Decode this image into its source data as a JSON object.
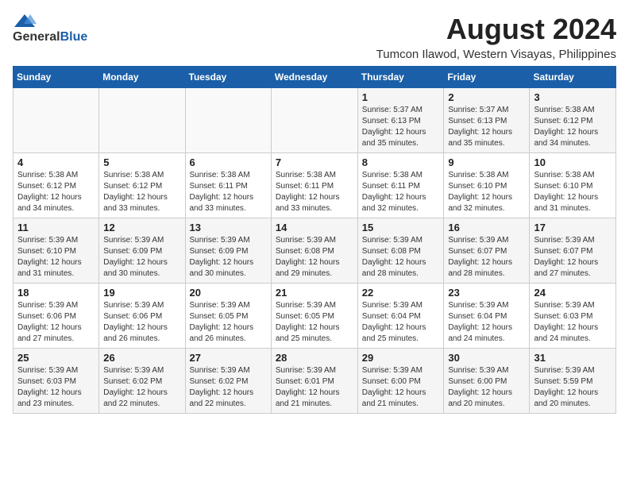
{
  "logo": {
    "general": "General",
    "blue": "Blue"
  },
  "title": {
    "month_year": "August 2024",
    "location": "Tumcon Ilawod, Western Visayas, Philippines"
  },
  "weekdays": [
    "Sunday",
    "Monday",
    "Tuesday",
    "Wednesday",
    "Thursday",
    "Friday",
    "Saturday"
  ],
  "weeks": [
    [
      {
        "day": "",
        "info": ""
      },
      {
        "day": "",
        "info": ""
      },
      {
        "day": "",
        "info": ""
      },
      {
        "day": "",
        "info": ""
      },
      {
        "day": "1",
        "info": "Sunrise: 5:37 AM\nSunset: 6:13 PM\nDaylight: 12 hours\nand 35 minutes."
      },
      {
        "day": "2",
        "info": "Sunrise: 5:37 AM\nSunset: 6:13 PM\nDaylight: 12 hours\nand 35 minutes."
      },
      {
        "day": "3",
        "info": "Sunrise: 5:38 AM\nSunset: 6:12 PM\nDaylight: 12 hours\nand 34 minutes."
      }
    ],
    [
      {
        "day": "4",
        "info": "Sunrise: 5:38 AM\nSunset: 6:12 PM\nDaylight: 12 hours\nand 34 minutes."
      },
      {
        "day": "5",
        "info": "Sunrise: 5:38 AM\nSunset: 6:12 PM\nDaylight: 12 hours\nand 33 minutes."
      },
      {
        "day": "6",
        "info": "Sunrise: 5:38 AM\nSunset: 6:11 PM\nDaylight: 12 hours\nand 33 minutes."
      },
      {
        "day": "7",
        "info": "Sunrise: 5:38 AM\nSunset: 6:11 PM\nDaylight: 12 hours\nand 33 minutes."
      },
      {
        "day": "8",
        "info": "Sunrise: 5:38 AM\nSunset: 6:11 PM\nDaylight: 12 hours\nand 32 minutes."
      },
      {
        "day": "9",
        "info": "Sunrise: 5:38 AM\nSunset: 6:10 PM\nDaylight: 12 hours\nand 32 minutes."
      },
      {
        "day": "10",
        "info": "Sunrise: 5:38 AM\nSunset: 6:10 PM\nDaylight: 12 hours\nand 31 minutes."
      }
    ],
    [
      {
        "day": "11",
        "info": "Sunrise: 5:39 AM\nSunset: 6:10 PM\nDaylight: 12 hours\nand 31 minutes."
      },
      {
        "day": "12",
        "info": "Sunrise: 5:39 AM\nSunset: 6:09 PM\nDaylight: 12 hours\nand 30 minutes."
      },
      {
        "day": "13",
        "info": "Sunrise: 5:39 AM\nSunset: 6:09 PM\nDaylight: 12 hours\nand 30 minutes."
      },
      {
        "day": "14",
        "info": "Sunrise: 5:39 AM\nSunset: 6:08 PM\nDaylight: 12 hours\nand 29 minutes."
      },
      {
        "day": "15",
        "info": "Sunrise: 5:39 AM\nSunset: 6:08 PM\nDaylight: 12 hours\nand 28 minutes."
      },
      {
        "day": "16",
        "info": "Sunrise: 5:39 AM\nSunset: 6:07 PM\nDaylight: 12 hours\nand 28 minutes."
      },
      {
        "day": "17",
        "info": "Sunrise: 5:39 AM\nSunset: 6:07 PM\nDaylight: 12 hours\nand 27 minutes."
      }
    ],
    [
      {
        "day": "18",
        "info": "Sunrise: 5:39 AM\nSunset: 6:06 PM\nDaylight: 12 hours\nand 27 minutes."
      },
      {
        "day": "19",
        "info": "Sunrise: 5:39 AM\nSunset: 6:06 PM\nDaylight: 12 hours\nand 26 minutes."
      },
      {
        "day": "20",
        "info": "Sunrise: 5:39 AM\nSunset: 6:05 PM\nDaylight: 12 hours\nand 26 minutes."
      },
      {
        "day": "21",
        "info": "Sunrise: 5:39 AM\nSunset: 6:05 PM\nDaylight: 12 hours\nand 25 minutes."
      },
      {
        "day": "22",
        "info": "Sunrise: 5:39 AM\nSunset: 6:04 PM\nDaylight: 12 hours\nand 25 minutes."
      },
      {
        "day": "23",
        "info": "Sunrise: 5:39 AM\nSunset: 6:04 PM\nDaylight: 12 hours\nand 24 minutes."
      },
      {
        "day": "24",
        "info": "Sunrise: 5:39 AM\nSunset: 6:03 PM\nDaylight: 12 hours\nand 24 minutes."
      }
    ],
    [
      {
        "day": "25",
        "info": "Sunrise: 5:39 AM\nSunset: 6:03 PM\nDaylight: 12 hours\nand 23 minutes."
      },
      {
        "day": "26",
        "info": "Sunrise: 5:39 AM\nSunset: 6:02 PM\nDaylight: 12 hours\nand 22 minutes."
      },
      {
        "day": "27",
        "info": "Sunrise: 5:39 AM\nSunset: 6:02 PM\nDaylight: 12 hours\nand 22 minutes."
      },
      {
        "day": "28",
        "info": "Sunrise: 5:39 AM\nSunset: 6:01 PM\nDaylight: 12 hours\nand 21 minutes."
      },
      {
        "day": "29",
        "info": "Sunrise: 5:39 AM\nSunset: 6:00 PM\nDaylight: 12 hours\nand 21 minutes."
      },
      {
        "day": "30",
        "info": "Sunrise: 5:39 AM\nSunset: 6:00 PM\nDaylight: 12 hours\nand 20 minutes."
      },
      {
        "day": "31",
        "info": "Sunrise: 5:39 AM\nSunset: 5:59 PM\nDaylight: 12 hours\nand 20 minutes."
      }
    ]
  ]
}
